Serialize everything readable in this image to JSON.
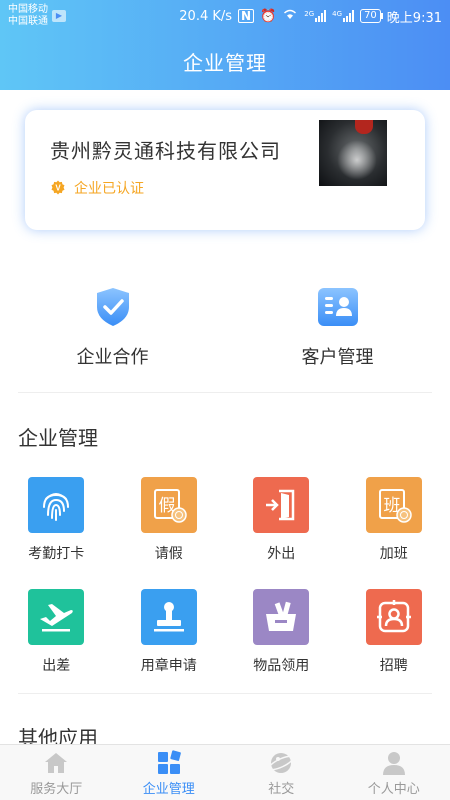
{
  "status_bar": {
    "carrier_1": "中国移动",
    "carrier_2": "中国联通",
    "speed": "20.4 K/s",
    "signal_1_tag": "2G",
    "signal_2_tag": "4G",
    "battery": "70",
    "time": "晚上9:31"
  },
  "header": {
    "title": "企业管理"
  },
  "company_card": {
    "name": "贵州黔灵通科技有限公司",
    "verified_label": "企业已认证",
    "verified_badge": "V"
  },
  "quick_entries": [
    {
      "label": "企业合作",
      "icon": "shield-check-icon"
    },
    {
      "label": "客户管理",
      "icon": "contact-card-icon"
    }
  ],
  "sections": {
    "enterprise_management": {
      "title": "企业管理",
      "items": [
        {
          "label": "考勤打卡",
          "icon": "fingerprint-icon",
          "color": "#3a9ff0"
        },
        {
          "label": "请假",
          "icon": "leave-stamp-icon",
          "color": "#f0a149"
        },
        {
          "label": "外出",
          "icon": "exit-door-icon",
          "color": "#ee6a4f"
        },
        {
          "label": "加班",
          "icon": "overtime-stamp-icon",
          "color": "#f0a149"
        },
        {
          "label": "出差",
          "icon": "airplane-icon",
          "color": "#1fc29b"
        },
        {
          "label": "用章申请",
          "icon": "seal-stamp-icon",
          "color": "#3a9ff0"
        },
        {
          "label": "物品领用",
          "icon": "supplies-box-icon",
          "color": "#9b87c5"
        },
        {
          "label": "招聘",
          "icon": "recruit-icon",
          "color": "#ee6a4f"
        }
      ]
    },
    "other_apps": {
      "title": "其他应用"
    }
  },
  "bottom_nav": [
    {
      "label": "服务大厅",
      "icon": "home-icon",
      "active": false
    },
    {
      "label": "企业管理",
      "icon": "grid-blocks-icon",
      "active": true
    },
    {
      "label": "社交",
      "icon": "planet-icon",
      "active": false
    },
    {
      "label": "个人中心",
      "icon": "person-icon",
      "active": false
    }
  ],
  "colors": {
    "header_gradient_start": "#5fc6f6",
    "header_gradient_end": "#4c8ef4",
    "accent": "#3a8ef6",
    "verified": "#f5a623"
  }
}
